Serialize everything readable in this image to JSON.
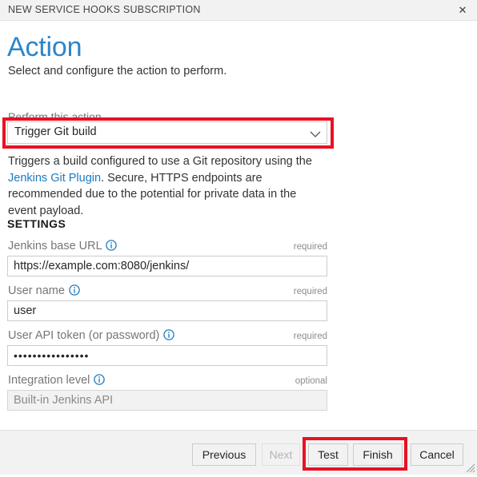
{
  "window": {
    "title": "NEW SERVICE HOOKS SUBSCRIPTION",
    "close_icon": "close-icon",
    "close_glyph": "✕"
  },
  "page": {
    "title": "Action",
    "subtitle": "Select and configure the action to perform."
  },
  "action_selector": {
    "label": "Perform this action",
    "selected": "Trigger Git build",
    "chevron_icon": "chevron-down-icon",
    "highlight_color": "#e81123"
  },
  "description": {
    "text_before": "Triggers a build configured to use a Git repository using the ",
    "link_text": "Jenkins Git Plugin",
    "text_after": ". Secure, HTTPS endpoints are recommended due to the potential for private data in the event payload.",
    "link_color": "#1b7ac2"
  },
  "settings": {
    "heading": "SETTINGS",
    "fields": [
      {
        "label": "Jenkins base URL",
        "info_icon": "info-icon",
        "requirement": "required",
        "value": "https://example.com:8080/jenkins/",
        "placeholder": "",
        "disabled": false,
        "masked": false
      },
      {
        "label": "User name",
        "info_icon": "info-icon",
        "requirement": "required",
        "value": "user",
        "placeholder": "",
        "disabled": false,
        "masked": false
      },
      {
        "label": "User API token (or password)",
        "info_icon": "info-icon",
        "requirement": "required",
        "value": "••••••••••••••••",
        "placeholder": "",
        "disabled": false,
        "masked": true
      },
      {
        "label": "Integration level",
        "info_icon": "info-icon",
        "requirement": "optional",
        "value": "Built-in Jenkins API",
        "placeholder": "",
        "disabled": true,
        "masked": false
      }
    ]
  },
  "footer": {
    "buttons": [
      {
        "label": "Previous",
        "disabled": false
      },
      {
        "label": "Next",
        "disabled": true
      },
      {
        "label": "Test",
        "disabled": false
      },
      {
        "label": "Finish",
        "disabled": false
      },
      {
        "label": "Cancel",
        "disabled": false
      }
    ],
    "highlight_color": "#e81123",
    "resize_grip_icon": "resize-grip-icon"
  }
}
